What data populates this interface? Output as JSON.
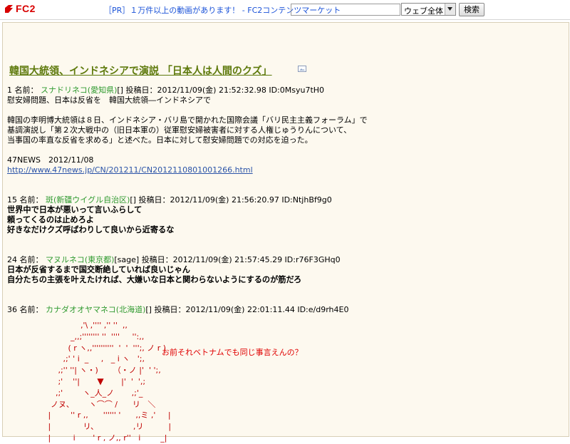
{
  "header": {
    "logo_text": "FC2",
    "pr_link": "［PR］１万件以上の動画があります！ - FC2コンテンツマーケット",
    "search_value": "",
    "scope": "ウェブ全体",
    "search_button": "検索"
  },
  "thread": {
    "title": "韓国大統領、インドネシアで演説 「日本人は人間のクズ」"
  },
  "posts": [
    {
      "num": "1",
      "name_label": "名前：",
      "name": "スナドリネコ(愛知県)",
      "mail": "[]",
      "date": "投稿日：2012/11/09(金) 21:52:32.98 ID:0Msyu7tH0",
      "lines": [
        "慰安婦問題、日本は反省を　韓国大統領―インドネシアで",
        "",
        "韓国の李明博大統領は８日、インドネシア・バリ島で開かれた国際会議「バリ民主主義フォーラム」で",
        "基調演説し「第２次大戦中の（旧日本軍の）従軍慰安婦被害者に対する人権じゅうりんについて、",
        "当事国の率直な反省を求める」と述べた。日本に対して慰安婦問題での対応を迫った。",
        "",
        "47NEWS　2012/11/08"
      ],
      "link": "http://www.47news.jp/CN/201211/CN2012110801001266.html"
    },
    {
      "num": "15",
      "name_label": "名前：",
      "name": "斑(新疆ウイグル自治区)",
      "mail": "[]",
      "date": "投稿日：2012/11/09(金) 21:56:20.97 ID:NtjhBf9g0",
      "lines": [
        "世界中で日本が悪いって言いふらして",
        "頼ってくるのは止めろよ",
        "好きなだけクズ呼ばわりして良いから近寄るな"
      ]
    },
    {
      "num": "24",
      "name_label": "名前：",
      "name": "マヌルネコ(東京都)",
      "mail": "[sage]",
      "date": "投稿日：2012/11/09(金) 21:57:45.29 ID:r76F3GHq0",
      "lines": [
        "日本が反省するまで国交断絶していれば良いじゃん",
        "自分たちの主張を叶えたければ、大嫌いな日本と関わらないようにするのが筋だろ"
      ]
    },
    {
      "num": "36",
      "name_label": "名前：",
      "name": "カナダオオヤマネコ(北海道)",
      "mail": "[]",
      "date": "投稿日：2012/11/09(金) 22:01:11.44 ID:e/d9rh4E0",
      "aa_text": "お前それベトナムでも同じ事言えんの？"
    }
  ],
  "colors": {
    "title": "#5e7a0c",
    "name": "#2f9a2f",
    "link": "#2a53a8",
    "aa": "#c00000",
    "panel_bg": "#fdf9ef"
  }
}
